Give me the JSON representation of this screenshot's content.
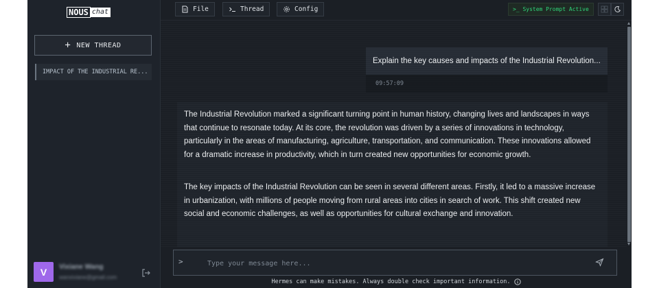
{
  "brand": {
    "name": "NOUS",
    "suffix": "chat"
  },
  "sidebar": {
    "new_thread_label": "NEW THREAD",
    "threads": [
      {
        "label": "IMPACT OF THE INDUSTRIAL RE..."
      }
    ],
    "user": {
      "initial": "V",
      "name": "Vixiane Wang",
      "email": "wanxiviane@gmail.com"
    }
  },
  "toolbar": {
    "file_label": "File",
    "thread_label": "Thread",
    "config_label": "Config",
    "system_prompt_label": ">_ System Prompt Active"
  },
  "conversation": {
    "user_message": "Explain the key causes and impacts of the Industrial Revolution...",
    "user_timestamp": "09:57:09",
    "assistant_paragraphs": [
      "The Industrial Revolution marked a significant turning point in human history, changing lives and landscapes in ways that continue to resonate today. At its core, the revolution was driven by a series of innovations in technology, particularly in the areas of manufacturing, agriculture, transportation, and communication. These innovations allowed for a dramatic increase in productivity, which in turn created new opportunities for economic growth.",
      "The key impacts of the Industrial Revolution can be seen in several different areas. Firstly, it led to a massive increase in urbanization, with millions of people moving from rural areas into cities in search of work. This shift created new social and economic challenges, as well as opportunities for cultural exchange and innovation."
    ]
  },
  "composer": {
    "prompt_symbol": ">",
    "placeholder": "Type your message here...",
    "value": ""
  },
  "footer_note": "Hermes can make mistakes. Always double check important information.",
  "colors": {
    "background": "#1b1f25",
    "sidebar": "#1e232b",
    "accent_green": "#2fd67a",
    "avatar": "#9f68ea"
  },
  "icons": [
    "file-icon",
    "terminal-icon",
    "gear-icon",
    "grid-icon",
    "moon-icon",
    "logout-icon",
    "send-icon",
    "info-icon",
    "plus-icon"
  ]
}
